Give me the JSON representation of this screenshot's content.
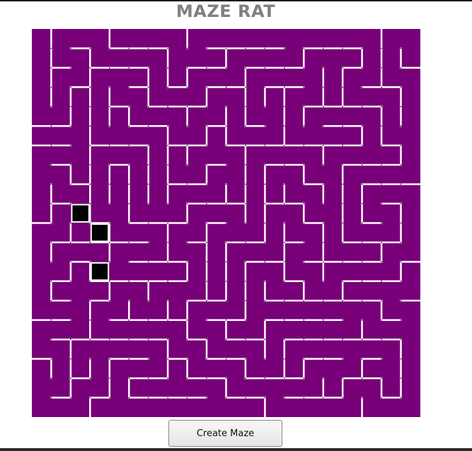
{
  "app": {
    "title": "MAZE RAT"
  },
  "controls": {
    "create_label": "Create Maze"
  },
  "maze": {
    "rows": 20,
    "cols": 20,
    "cell_color": "#780078",
    "wall_color": "#ffffff",
    "marker_color": "#000000",
    "marked_cells": [
      {
        "row": 9,
        "col": 2
      },
      {
        "row": 10,
        "col": 3
      },
      {
        "row": 12,
        "col": 3
      }
    ]
  },
  "colors": {
    "title": "#808080",
    "background": "#ffffff"
  }
}
